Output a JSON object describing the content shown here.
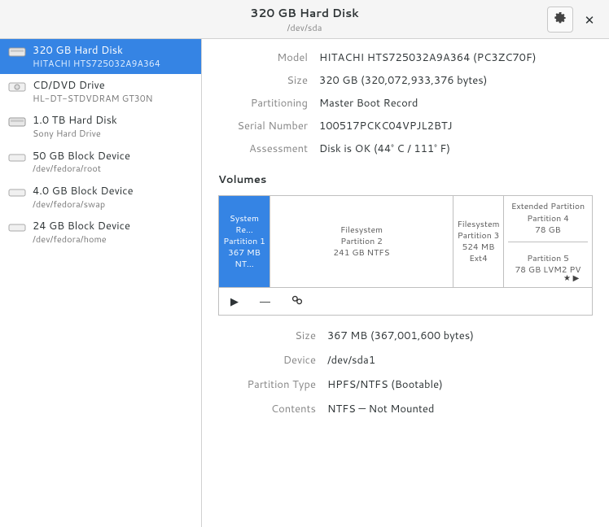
{
  "titlebar": {
    "title": "320 GB Hard Disk",
    "subtitle": "/dev/sda"
  },
  "devices": [
    {
      "title": "320 GB Hard Disk",
      "sub": "HITACHI HTS725032A9A364",
      "selected": true,
      "icon": "hdd"
    },
    {
      "title": "CD/DVD Drive",
      "sub": "HL-DT-STDVDRAM GT30N",
      "selected": false,
      "icon": "optical"
    },
    {
      "title": "1.0 TB Hard Disk",
      "sub": "Sony Hard Drive",
      "selected": false,
      "icon": "hdd"
    },
    {
      "title": "50 GB Block Device",
      "sub": "/dev/fedora/root",
      "selected": false,
      "icon": "block"
    },
    {
      "title": "4.0 GB Block Device",
      "sub": "/dev/fedora/swap",
      "selected": false,
      "icon": "block"
    },
    {
      "title": "24 GB Block Device",
      "sub": "/dev/fedora/home",
      "selected": false,
      "icon": "block"
    }
  ],
  "disk": {
    "model_label": "Model",
    "model": "HITACHI HTS725032A9A364 (PC3ZC70F)",
    "size_label": "Size",
    "size": "320 GB (320,072,933,376 bytes)",
    "part_label": "Partitioning",
    "partitioning": "Master Boot Record",
    "serial_label": "Serial Number",
    "serial": "100517PCKC04VPJL2BTJ",
    "assess_label": "Assessment",
    "assessment": "Disk is OK (44° C / 111° F)"
  },
  "volumes_heading": "Volumes",
  "volumes": {
    "p1": {
      "l1": "System Re…",
      "l2": "Partition 1",
      "l3": "367 MB NT…"
    },
    "p2": {
      "l1": "Filesystem",
      "l2": "Partition 2",
      "l3": "241 GB NTFS"
    },
    "p3": {
      "l1": "Filesystem",
      "l2": "Partition 3",
      "l3": "524 MB Ext4"
    },
    "p4": {
      "l1": "Extended Partition",
      "l2": "Partition 4",
      "l3": "78 GB"
    },
    "p5": {
      "l1": "Partition 5",
      "l2": "78 GB LVM2 PV"
    }
  },
  "partition": {
    "size_label": "Size",
    "size": "367 MB (367,001,600 bytes)",
    "device_label": "Device",
    "device": "/dev/sda1",
    "type_label": "Partition Type",
    "type": "HPFS/NTFS (Bootable)",
    "contents_label": "Contents",
    "contents": "NTFS — Not Mounted"
  }
}
